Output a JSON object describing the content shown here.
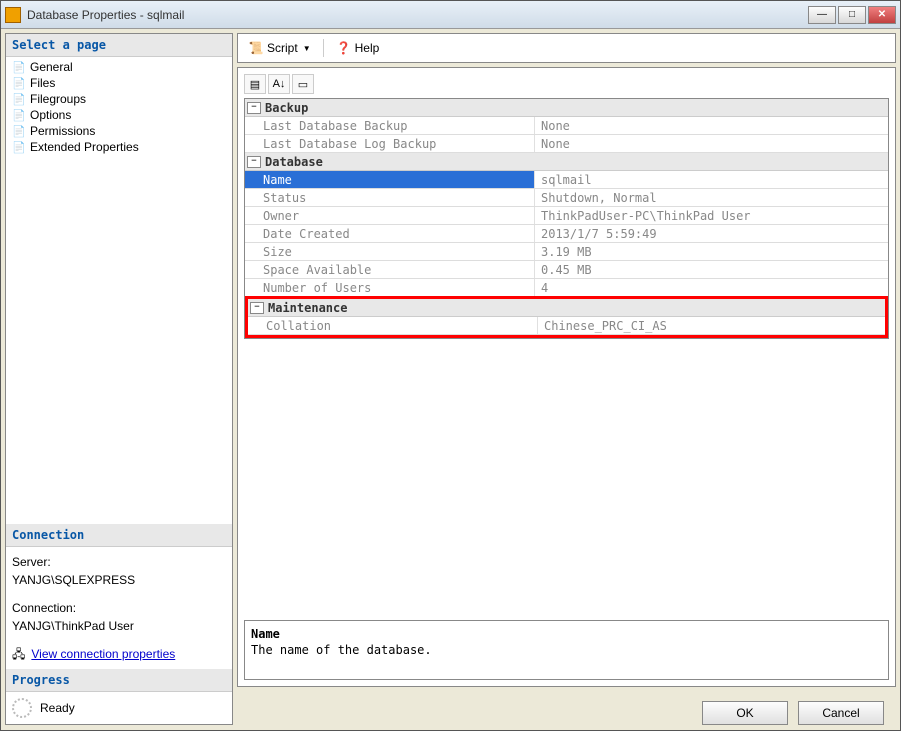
{
  "window": {
    "title": "Database Properties - sqlmail"
  },
  "left": {
    "select_a_page": "Select a page",
    "pages": [
      {
        "label": "General"
      },
      {
        "label": "Files"
      },
      {
        "label": "Filegroups"
      },
      {
        "label": "Options"
      },
      {
        "label": "Permissions"
      },
      {
        "label": "Extended Properties"
      }
    ],
    "connection_header": "Connection",
    "server_label": "Server:",
    "server_value": "YANJG\\SQLEXPRESS",
    "connection_label": "Connection:",
    "connection_value": "YANJG\\ThinkPad User",
    "view_conn_props": "View connection properties",
    "progress_header": "Progress",
    "progress_status": "Ready"
  },
  "toolbar": {
    "script": "Script",
    "help": "Help"
  },
  "propgrid": {
    "sections": [
      {
        "title": "Backup",
        "rows": [
          {
            "label": "Last Database Backup",
            "value": "None"
          },
          {
            "label": "Last Database Log Backup",
            "value": "None"
          }
        ]
      },
      {
        "title": "Database",
        "rows": [
          {
            "label": "Name",
            "value": "sqlmail",
            "selected": true
          },
          {
            "label": "Status",
            "value": "Shutdown, Normal"
          },
          {
            "label": "Owner",
            "value": "ThinkPadUser-PC\\ThinkPad User"
          },
          {
            "label": "Date Created",
            "value": "2013/1/7 5:59:49"
          },
          {
            "label": "Size",
            "value": "3.19 MB"
          },
          {
            "label": "Space Available",
            "value": "0.45 MB"
          },
          {
            "label": "Number of Users",
            "value": "4"
          }
        ]
      },
      {
        "title": "Maintenance",
        "highlight": true,
        "rows": [
          {
            "label": "Collation",
            "value": "Chinese_PRC_CI_AS"
          }
        ]
      }
    ]
  },
  "helpbox": {
    "title": "Name",
    "description": "The name of the database."
  },
  "buttons": {
    "ok": "OK",
    "cancel": "Cancel"
  }
}
